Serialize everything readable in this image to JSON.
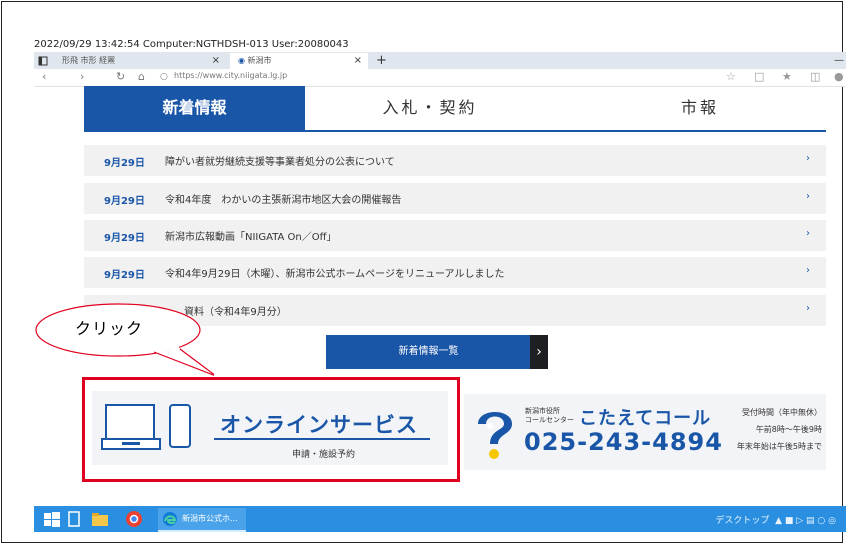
{
  "stamp": "2022/09/29 13:42:54 Computer:NGTHDSH-013 User:20080043",
  "browser": {
    "tabs": [
      {
        "label": "形飛 市形 経罴",
        "close": "×"
      },
      {
        "label": "新潟市",
        "close": "×"
      }
    ],
    "new_tab": "+",
    "minimize": "—",
    "url": "https://www.city.niigata.lg.jp"
  },
  "news": {
    "tabs": [
      "新着情報",
      "入札・契約",
      "市報"
    ],
    "items": [
      {
        "date": "9月29日",
        "title": "障がい者就労継続支援等事業者処分の公表について",
        "arrow": "›"
      },
      {
        "date": "9月29日",
        "title": "令和4年度　わかいの主張新潟市地区大会の開催報告",
        "arrow": "›"
      },
      {
        "date": "9月29日",
        "title": "新潟市広報動画「NIIGATA On／Off」",
        "arrow": "›"
      },
      {
        "date": "9月29日",
        "title": "令和4年9月29日（木曜）、新潟市公式ホームページをリニューアルしました",
        "arrow": "›"
      },
      {
        "date": "",
        "title": "資料（令和4年9月分）",
        "arrow": "›"
      }
    ],
    "more_label": "新着情報一覧",
    "more_chevron": "›"
  },
  "callout": "クリック",
  "online_service": {
    "title": "オンラインサービス",
    "subtitle": "申請・施設予約"
  },
  "call_center": {
    "small_line1": "新潟市役所",
    "small_line2": "コールセンター",
    "name": "こたえてコール",
    "phone": "025-243-4894",
    "hours_line1": "受付時間（年中無休）",
    "hours_line2": "午前8時～午後9時",
    "hours_line3": "年末年始は午後5時まで"
  },
  "taskbar": {
    "app_label": "新潟市公式ホ...",
    "tray": "デスクトップ"
  },
  "colors": {
    "accent": "#1a56a8",
    "highlight": "#e0001f",
    "taskbar": "#2a8fe0"
  }
}
